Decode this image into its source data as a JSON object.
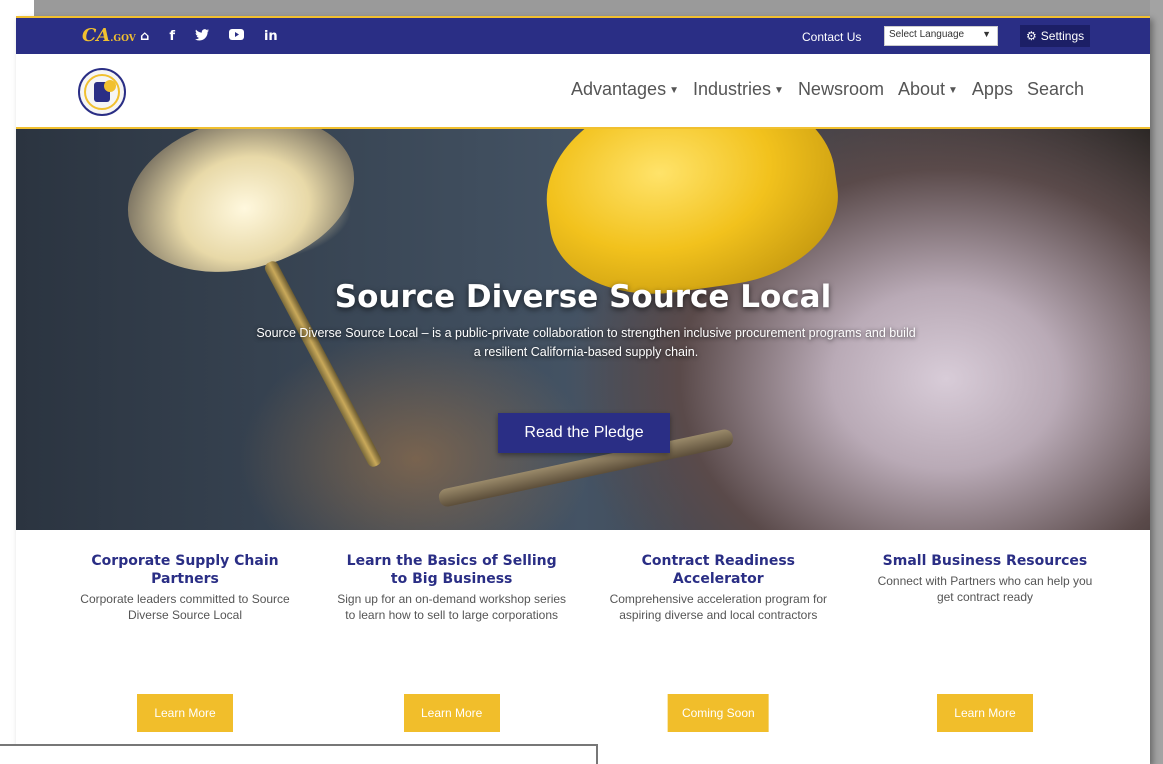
{
  "topbar": {
    "gov_logo_text": "CA",
    "gov_logo_suffix": ".GOV",
    "social_icons": [
      "home-icon",
      "facebook-icon",
      "twitter-icon",
      "youtube-icon",
      "linkedin-icon"
    ],
    "social_glyphs": [
      "⌂",
      "f",
      "🐦",
      "▶",
      "in"
    ],
    "contact_label": "Contact Us",
    "language_select_value": "Select Language",
    "settings_label": "Settings"
  },
  "nav": {
    "items": [
      {
        "label": "Advantages",
        "dropdown": true
      },
      {
        "label": "Industries",
        "dropdown": true
      },
      {
        "label": "Newsroom",
        "dropdown": false
      },
      {
        "label": "About",
        "dropdown": true
      },
      {
        "label": "Apps",
        "dropdown": false
      },
      {
        "label": "Search",
        "dropdown": false
      }
    ]
  },
  "hero": {
    "title": "Source Diverse Source Local",
    "subtitle": "Source Diverse Source Local – is a public-private collaboration to strengthen inclusive procurement programs and build a resilient California-based supply chain.",
    "button_label": "Read the Pledge"
  },
  "cards": [
    {
      "title": "Corporate Supply Chain Partners",
      "text": "Corporate leaders committed to Source Diverse Source Local",
      "button": "Learn More"
    },
    {
      "title": "Learn the Basics of Selling to Big Business",
      "text": "Sign up for an on-demand workshop series to learn how to sell to large corporations",
      "button": "Learn More"
    },
    {
      "title": "Contract Readiness Accelerator",
      "text": "Comprehensive acceleration program for aspiring diverse and local contractors",
      "button": "Coming Soon"
    },
    {
      "title": "Small Business Resources",
      "text": "Connect with Partners who can help you get contract ready",
      "button": "Learn More"
    }
  ],
  "colors": {
    "brand_navy": "#2a2e85",
    "accent_gold": "#f1c02f"
  }
}
